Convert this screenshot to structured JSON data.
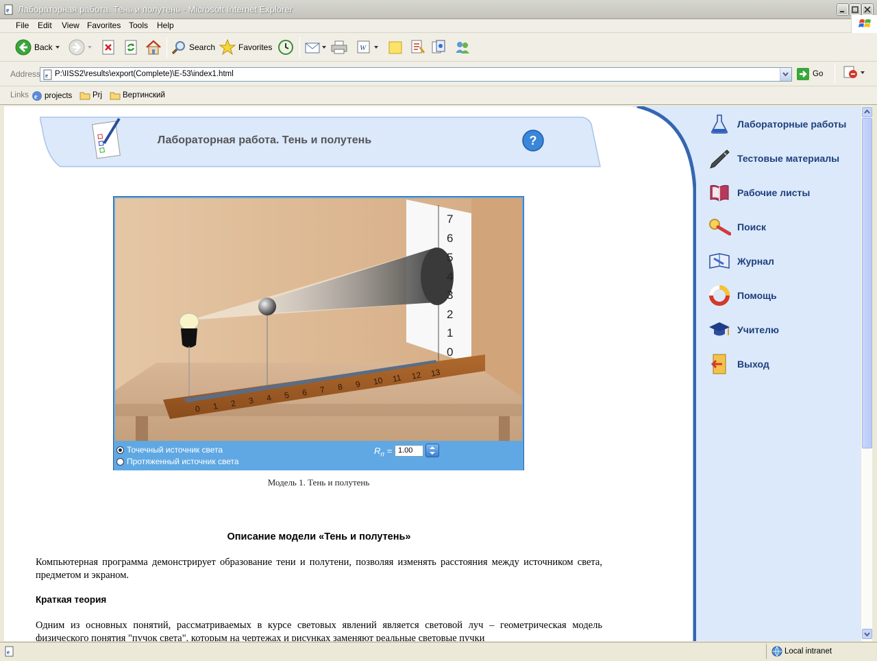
{
  "window": {
    "title": "Лабораторная работа. Тень и полутень - Microsoft Internet Explorer"
  },
  "menu": [
    "File",
    "Edit",
    "View",
    "Favorites",
    "Tools",
    "Help"
  ],
  "toolbar": {
    "back": "Back",
    "search": "Search",
    "favorites": "Favorites"
  },
  "address": {
    "label": "Address",
    "url": "P:\\IISS2\\results\\export(Complete)\\E-53\\index1.html",
    "go": "Go"
  },
  "links": {
    "label": "Links",
    "items": [
      "projects",
      "Prj",
      "Вертинский"
    ]
  },
  "page": {
    "banner_title": "Лабораторная работа. Тень и полутень",
    "help_symbol": "?",
    "model": {
      "ruler_vertical": [
        "7",
        "6",
        "5",
        "4",
        "3",
        "2",
        "1",
        "0"
      ],
      "ruler_horizontal": [
        "0",
        "1",
        "2",
        "3",
        "4",
        "5",
        "6",
        "7",
        "8",
        "9",
        "10",
        "11",
        "12",
        "13"
      ],
      "option_point": "Точечный источник света",
      "option_extended": "Протяженный источник света",
      "selected_option": "point",
      "r_label": "R",
      "r_subscript": "п",
      "r_eq": "=",
      "r_value": "1.00"
    },
    "caption": "Модель 1. Тень и полутень",
    "section_title": "Описание модели «Тень и полутень»",
    "para1": "Компьютерная программа демонстрирует образование тени и полутени, позволяя изменять расстояния между источником света, предметом и экраном.",
    "section2_title": "Краткая теория",
    "para2": "Одним из основных понятий, рассматриваемых в курсе световых явлений является световой луч – геометрическая модель физического понятия \"пучок света\", которым на чертежах и рисунках заменяют реальные световые пучки"
  },
  "sidebar": {
    "items": [
      {
        "label": "Лабораторные работы",
        "icon": "flask-icon"
      },
      {
        "label": "Тестовые материалы",
        "icon": "pen-icon"
      },
      {
        "label": "Рабочие листы",
        "icon": "book-icon"
      },
      {
        "label": "Поиск",
        "icon": "magnifier-icon"
      },
      {
        "label": "Журнал",
        "icon": "journal-icon"
      },
      {
        "label": "Помощь",
        "icon": "lifebuoy-icon"
      },
      {
        "label": "Учителю",
        "icon": "mortarboard-icon"
      },
      {
        "label": "Выход",
        "icon": "exit-door-icon"
      }
    ]
  },
  "status": {
    "zone": "Local intranet"
  }
}
